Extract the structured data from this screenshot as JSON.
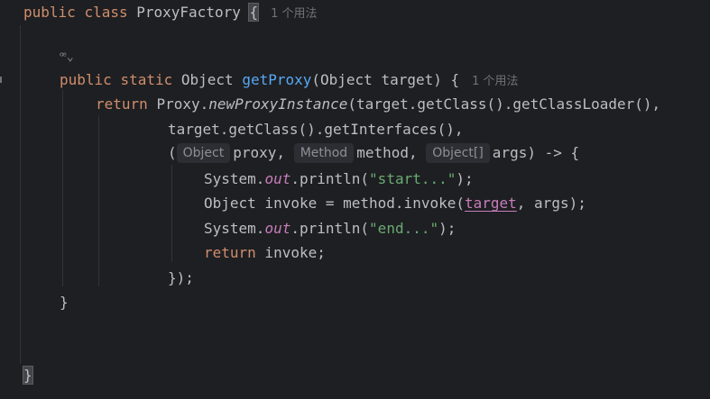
{
  "code": {
    "line1": {
      "kw1": "public",
      "kw2": "class",
      "name": "ProxyFactory",
      "brace": "{",
      "usages": "1 个用法"
    },
    "line3": {
      "icon": "lambda-lens-icon",
      "icon_glyph": "ꟹ⌄"
    },
    "line4": {
      "kw1": "public",
      "kw2": "static",
      "type": "Object",
      "method": "getProxy",
      "params": "(Object target) {",
      "usages": "1 个用法"
    },
    "line5": {
      "kw": "return",
      "prefix": "Proxy.",
      "call": "newProxyInstance",
      "rest": "(target.getClass().getClassLoader(),"
    },
    "line6": {
      "text": "target.getClass().getInterfaces(),"
    },
    "line7": {
      "open": "(",
      "hint1": "Object",
      "p1": "proxy, ",
      "hint2": "Method",
      "p2": "method, ",
      "hint3": "Object[]",
      "p3": "args) -> {"
    },
    "line8": {
      "prefix": "System.",
      "field": "out",
      "mid": ".println(",
      "str": "\"start...\"",
      "end": ");"
    },
    "line9": {
      "prefix": "Object invoke = method.invoke(",
      "field": "target",
      "end": ", args);"
    },
    "line10": {
      "prefix": "System.",
      "field": "out",
      "mid": ".println(",
      "str": "\"end...\"",
      "end": ");"
    },
    "line11": {
      "kw": "return",
      "rest": " invoke;"
    },
    "line12": {
      "text": "});"
    },
    "line13": {
      "text": "}"
    },
    "line16": {
      "text": "}"
    }
  }
}
